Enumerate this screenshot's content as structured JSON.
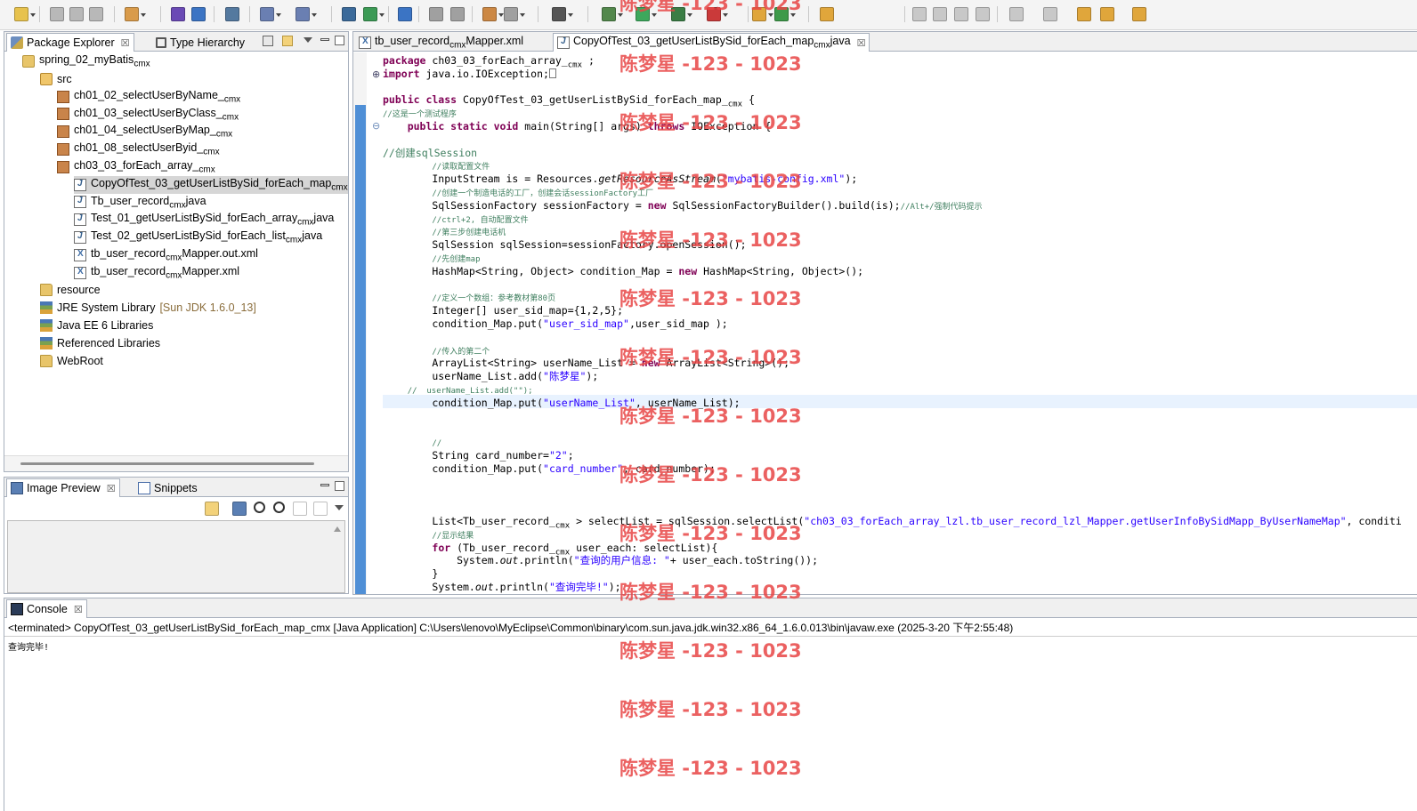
{
  "toolbar": {
    "icons": [
      "new-wizard",
      "save",
      "save-all",
      "print",
      "new-java-project",
      "open-type",
      "open-type-hierarchy",
      "debug",
      "search",
      "run",
      "coverage",
      "external-tools",
      "open-task",
      "browse",
      "server",
      "deploy",
      "tomcat",
      "web-browser",
      "image-preview",
      "run-last",
      "debug-last",
      "refresh",
      "undo",
      "go-back",
      "go-forward"
    ]
  },
  "package_explorer": {
    "tabs": [
      {
        "label": "Package Explorer",
        "close": "☒"
      },
      {
        "label": "Type Hierarchy"
      }
    ],
    "tree": [
      {
        "level": 0,
        "icon": "project",
        "label": "spring_02_myBatis",
        "suffix": "cmx"
      },
      {
        "level": 1,
        "icon": "source-folder",
        "label": "src"
      },
      {
        "level": 2,
        "icon": "package",
        "label": "ch01_02_selectUserByName_",
        "suffix": "cmx"
      },
      {
        "level": 2,
        "icon": "package",
        "label": "ch01_03_selectUserByClass_",
        "suffix": "cmx"
      },
      {
        "level": 2,
        "icon": "package",
        "label": "ch01_04_selectUserByMap_",
        "suffix": "cmx"
      },
      {
        "level": 2,
        "icon": "package",
        "label": "ch01_08_selectUserByid_",
        "suffix": "cmx"
      },
      {
        "level": 2,
        "icon": "package",
        "label": "ch03_03_forEach_array_",
        "suffix": "cmx"
      },
      {
        "level": 3,
        "icon": "java",
        "label": "CopyOfTest_03_getUserListBySid_forEach_map",
        "suffix": "cmx",
        "selected": true
      },
      {
        "level": 3,
        "icon": "java",
        "label": "Tb_user_record",
        "suffix": "cmx",
        "after": "java"
      },
      {
        "level": 3,
        "icon": "java",
        "label": "Test_01_getUserListBySid_forEach_array",
        "suffix": "cmx",
        "after": "java"
      },
      {
        "level": 3,
        "icon": "java",
        "label": "Test_02_getUserListBySid_forEach_list",
        "suffix": "cmx",
        "after": "java"
      },
      {
        "level": 3,
        "icon": "xml",
        "label": "tb_user_record",
        "suffix": "cmx",
        "after": "Mapper.out.xml"
      },
      {
        "level": 3,
        "icon": "xml",
        "label": "tb_user_record",
        "suffix": "cmx",
        "after": "Mapper.xml"
      },
      {
        "level": 1,
        "icon": "folder",
        "label": "resource"
      },
      {
        "level": 1,
        "icon": "library",
        "label": "JRE System Library",
        "extra": "[Sun JDK 1.6.0_13]"
      },
      {
        "level": 1,
        "icon": "library",
        "label": "Java EE 6 Libraries"
      },
      {
        "level": 1,
        "icon": "library",
        "label": "Referenced Libraries"
      },
      {
        "level": 1,
        "icon": "folder",
        "label": "WebRoot"
      }
    ]
  },
  "image_preview": {
    "tabs": [
      {
        "label": "Image Preview",
        "close": "☒"
      },
      {
        "label": "Snippets"
      }
    ]
  },
  "editor": {
    "tabs": [
      {
        "label": "tb_user_record",
        "suffix": "cmx",
        "after": "Mapper.xml"
      },
      {
        "label": "CopyOfTest_03_getUserListBySid_forEach_map",
        "suffix": "cmx",
        "after": "java",
        "close": "☒"
      }
    ],
    "lines": [
      [
        [
          "kw",
          "package"
        ],
        [
          "",
          "ch03_03_forEach_array_"
        ],
        [
          "sm",
          "cmx"
        ],
        [
          "",
          ";"
        ]
      ],
      [
        [
          "kw",
          "import"
        ],
        [
          "",
          "java.io.IOException;"
        ],
        [
          "box",
          ""
        ]
      ],
      [],
      [
        [
          "kw",
          "public class"
        ],
        [
          "",
          "CopyOfTest_03_getUserListBySid_forEach_map_"
        ],
        [
          "sm",
          "cmx"
        ],
        [
          "",
          "{"
        ]
      ],
      [
        [
          "cm",
          "//这是一个测试程序"
        ]
      ],
      [
        [
          "",
          "    "
        ],
        [
          "kw",
          "public static void"
        ],
        [
          "",
          "main(String[] args) "
        ],
        [
          "kw",
          "throws"
        ],
        [
          "",
          "IOException {"
        ]
      ],
      [],
      [
        [
          "cm2",
          "//创建sqlSession"
        ]
      ],
      [
        [
          "",
          "        "
        ],
        [
          "cm",
          "//读取配置文件"
        ]
      ],
      [
        [
          "",
          "        InputStream is = Resources."
        ],
        [
          "it",
          "getResourceAsStream"
        ],
        [
          "",
          "("
        ],
        [
          "st",
          "\"mybatis-config.xml\""
        ],
        [
          "",
          ");"
        ]
      ],
      [
        [
          "",
          "        "
        ],
        [
          "cm",
          "//创建一个制造电话的工厂，创建会话sessionFactory工厂"
        ]
      ],
      [
        [
          "",
          "        SqlSessionFactory sessionFactory = "
        ],
        [
          "kw",
          "new"
        ],
        [
          "",
          "SqlSessionFactoryBuilder().build(is);"
        ],
        [
          "cm",
          "//Alt+/强制代码提示"
        ]
      ],
      [
        [
          "",
          "        "
        ],
        [
          "cm",
          "//ctrl+2, 自动配置文件"
        ]
      ],
      [
        [
          "",
          "        "
        ],
        [
          "cm",
          "//第三步创建电话机"
        ]
      ],
      [
        [
          "",
          "        SqlSession sqlSession=sessionFactory.openSession();"
        ]
      ],
      [
        [
          "",
          "        "
        ],
        [
          "cm",
          "//先创建map"
        ]
      ],
      [
        [
          "",
          "        HashMap<String, Object> condition_Map = "
        ],
        [
          "kw",
          "new"
        ],
        [
          "",
          "HashMap<String, Object>();"
        ]
      ],
      [],
      [
        [
          "",
          "        "
        ],
        [
          "cm",
          "//定义一个数组：参考教材第80页"
        ]
      ],
      [
        [
          "",
          "        Integer[] user_sid_map={1,2,5};"
        ]
      ],
      [
        [
          "",
          "        condition_Map.put("
        ],
        [
          "st",
          "\"user_sid_map\""
        ],
        [
          "",
          ",user_sid_map );"
        ]
      ],
      [],
      [
        [
          "",
          "        "
        ],
        [
          "cm",
          "//传入的第二个"
        ]
      ],
      [
        [
          "",
          "        ArrayList<String> userName_List = "
        ],
        [
          "kw",
          "new"
        ],
        [
          "",
          "ArrayList<String>();"
        ]
      ],
      [
        [
          "",
          "        userName_List.add("
        ],
        [
          "st",
          "\"陈梦星\""
        ],
        [
          "",
          ");"
        ]
      ],
      [
        [
          "",
          "    "
        ],
        [
          "cm",
          "//  userName_List.add(\"\");"
        ]
      ],
      [
        [
          "",
          "        condition_Map.put("
        ],
        [
          "st",
          "\"userName_List\""
        ],
        [
          "",
          ", userName_List);"
        ]
      ],
      [],
      [],
      [
        [
          "",
          "        "
        ],
        [
          "cm",
          "//"
        ]
      ],
      [
        [
          "",
          "        String card_number="
        ],
        [
          "st",
          "\"2\""
        ],
        [
          "",
          ";"
        ]
      ],
      [
        [
          "",
          "        condition_Map.put("
        ],
        [
          "st",
          "\"card_number\""
        ],
        [
          "",
          ", card_number);"
        ]
      ],
      [],
      [],
      [],
      [
        [
          "",
          "        List<Tb_user_record_"
        ],
        [
          "sm",
          "cmx"
        ],
        [
          "",
          "> selectList = sqlSession.selectList("
        ],
        [
          "st",
          "\"ch03_03_forEach_array_lzl.tb_user_record_lzl_Mapper.getUserInfoBySidMapp_ByUserNameMap\""
        ],
        [
          "",
          ", conditi"
        ]
      ],
      [
        [
          "",
          "        "
        ],
        [
          "cm",
          "//显示结果"
        ]
      ],
      [
        [
          "",
          "        "
        ],
        [
          "kw",
          "for"
        ],
        [
          "",
          "(Tb_user_record_"
        ],
        [
          "sm",
          "cmx"
        ],
        [
          "",
          "user_each: selectList){"
        ]
      ],
      [
        [
          "",
          "            System."
        ],
        [
          "it",
          "out"
        ],
        [
          "",
          ".println("
        ],
        [
          "st",
          "\"查询的用户信息: \""
        ],
        [
          "",
          "+ user_each.toString());"
        ]
      ],
      [
        [
          "",
          "        }"
        ]
      ],
      [
        [
          "",
          "        System."
        ],
        [
          "it",
          "out"
        ],
        [
          "",
          ".println("
        ],
        [
          "st",
          "\"查询完毕!\""
        ],
        [
          "",
          ");"
        ]
      ]
    ]
  },
  "console": {
    "tab": {
      "label": "Console",
      "close": "☒"
    },
    "status": "<terminated> CopyOfTest_03_getUserListBySid_forEach_map_cmx [Java Application] C:\\Users\\lenovo\\MyEclipse\\Common\\binary\\com.sun.java.jdk.win32.x86_64_1.6.0.013\\bin\\javaw.exe (2025-3-20 下午2:55:48)",
    "output": "查询完毕!"
  },
  "watermark": {
    "text": "陈梦星 -123 - 1023",
    "color": "#e84646"
  }
}
